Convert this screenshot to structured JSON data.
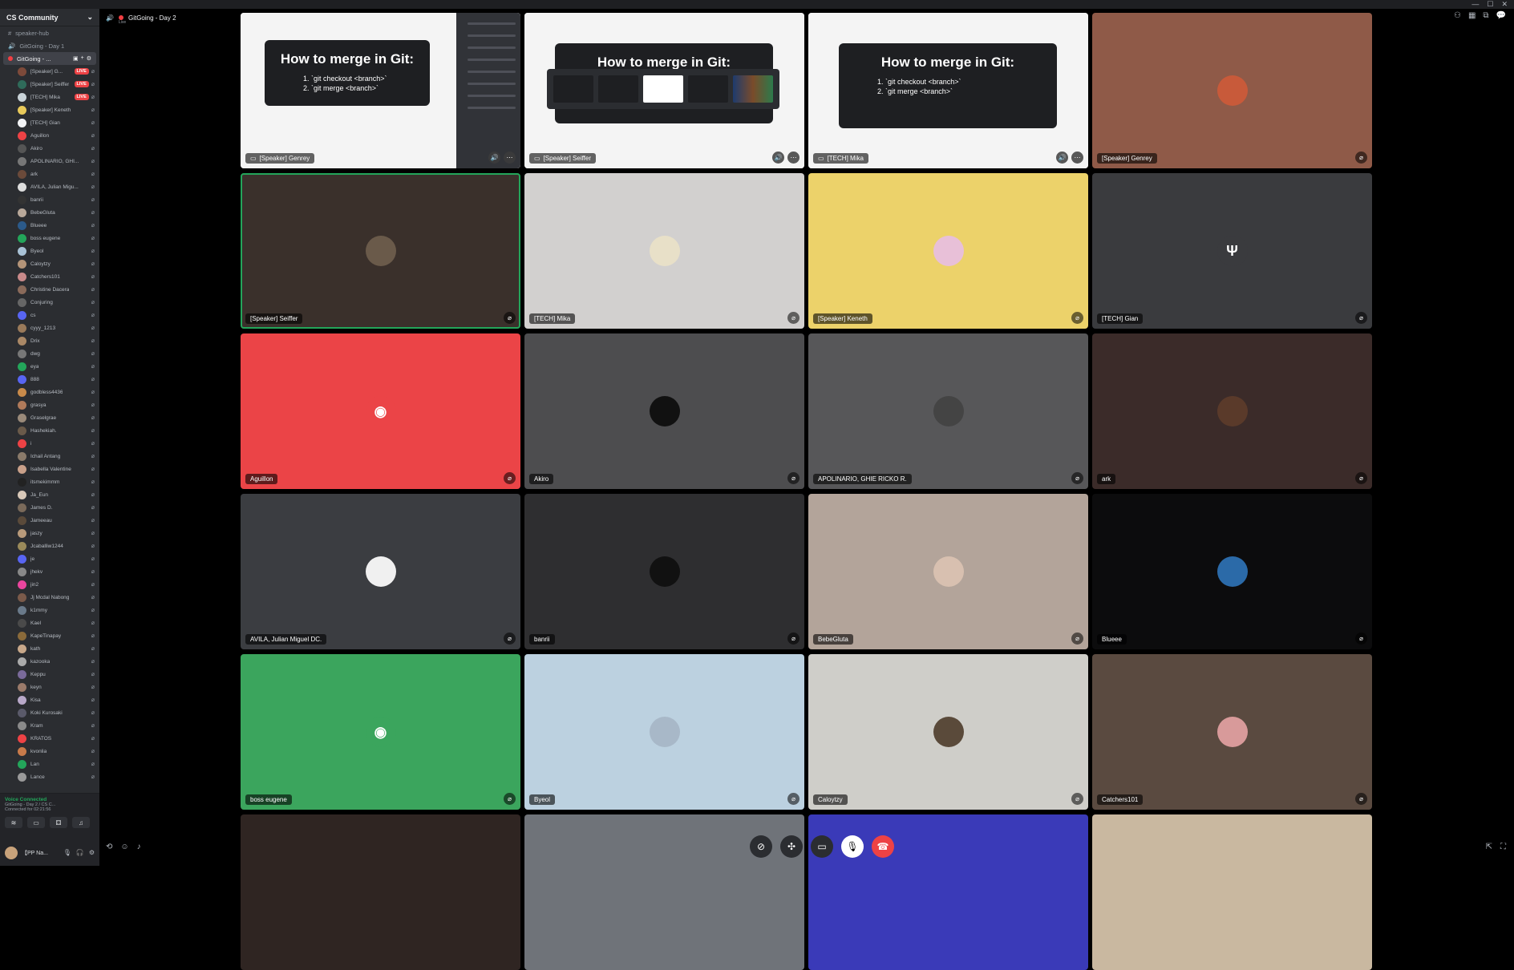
{
  "server": {
    "name": "CS Community"
  },
  "channels": [
    {
      "label": "speaker-hub",
      "icon": "hash-icon"
    },
    {
      "label": "GitGoing - Day 1",
      "icon": "speaker-icon"
    }
  ],
  "active_channel": {
    "label": "GitGoing - ..."
  },
  "members": [
    {
      "name": "[Speaker] G...",
      "live": "LIVE",
      "color": "#7d4a3a"
    },
    {
      "name": "[Speaker] Seiffer",
      "live": "LIVE",
      "color": "#2f6b5a"
    },
    {
      "name": "[TECH] Mika",
      "live": "LIVE",
      "color": "#c9d3d8"
    },
    {
      "name": "[Speaker] Keneth",
      "live": "",
      "color": "#e8c95a"
    },
    {
      "name": "[TECH] Gian",
      "live": "",
      "color": "#f2f3f5"
    },
    {
      "name": "Aguillon",
      "live": "",
      "color": "#ed4245"
    },
    {
      "name": "Akiro",
      "live": "",
      "color": "#555"
    },
    {
      "name": "APOLINARIO, GHI...",
      "live": "",
      "color": "#777"
    },
    {
      "name": "ark",
      "live": "",
      "color": "#6b4a3a"
    },
    {
      "name": "AVILA, Julian Migu...",
      "live": "",
      "color": "#ddd"
    },
    {
      "name": "banrii",
      "live": "",
      "color": "#333"
    },
    {
      "name": "BebeGluta",
      "live": "",
      "color": "#b8a89a"
    },
    {
      "name": "Blueee",
      "live": "",
      "color": "#2b5a8a"
    },
    {
      "name": "boss eugene",
      "live": "",
      "color": "#23a55a"
    },
    {
      "name": "Byeol",
      "live": "",
      "color": "#a9c2d6"
    },
    {
      "name": "Caloytzy",
      "live": "",
      "color": "#b49478"
    },
    {
      "name": "Catchers101",
      "live": "",
      "color": "#c98a8a"
    },
    {
      "name": "Christine Dacera",
      "live": "",
      "color": "#8a6a5a"
    },
    {
      "name": "Conjuring",
      "live": "",
      "color": "#666"
    },
    {
      "name": "cs",
      "live": "",
      "color": "#5865f2"
    },
    {
      "name": "cyyy_1213",
      "live": "",
      "color": "#9a7a5a"
    },
    {
      "name": "Drix",
      "live": "",
      "color": "#aa8866"
    },
    {
      "name": "dwg",
      "live": "",
      "color": "#777"
    },
    {
      "name": "eya",
      "live": "",
      "color": "#23a55a"
    },
    {
      "name": "888",
      "live": "",
      "color": "#5865f2"
    },
    {
      "name": "godbless4436",
      "live": "",
      "color": "#c88a4a"
    },
    {
      "name": "grasya",
      "live": "",
      "color": "#b07a5a"
    },
    {
      "name": "Graselgrae",
      "live": "",
      "color": "#9a8a7a"
    },
    {
      "name": "Hashekiah.",
      "live": "",
      "color": "#6a5a4a"
    },
    {
      "name": "i",
      "live": "",
      "color": "#ed4245"
    },
    {
      "name": "Ichail Antang",
      "live": "",
      "color": "#8a7a6a"
    },
    {
      "name": "Isabella Valentine",
      "live": "",
      "color": "#c9a08a"
    },
    {
      "name": "itsmekimmm",
      "live": "",
      "color": "#222"
    },
    {
      "name": "Ja_Eun",
      "live": "",
      "color": "#d8c8b8"
    },
    {
      "name": "James D.",
      "live": "",
      "color": "#7a6a5a"
    },
    {
      "name": "Jameeau",
      "live": "",
      "color": "#5a4a3a"
    },
    {
      "name": "jaszy",
      "live": "",
      "color": "#b89a7a"
    },
    {
      "name": "Jcaballiw1244",
      "live": "",
      "color": "#9a8a5a"
    },
    {
      "name": "je",
      "live": "",
      "color": "#5865f2"
    },
    {
      "name": "jhekv",
      "live": "",
      "color": "#888"
    },
    {
      "name": "jin2",
      "live": "",
      "color": "#eb459e"
    },
    {
      "name": "Jj Mcdal Nabong",
      "live": "",
      "color": "#7a5a4a"
    },
    {
      "name": "k1mmy",
      "live": "",
      "color": "#6a7a8a"
    },
    {
      "name": "Kael",
      "live": "",
      "color": "#4a4a4a"
    },
    {
      "name": "KapeTinapay",
      "live": "",
      "color": "#8a6a3a"
    },
    {
      "name": "kath",
      "live": "",
      "color": "#c8a88a"
    },
    {
      "name": "kazooka",
      "live": "",
      "color": "#aaa"
    },
    {
      "name": "Keppu",
      "live": "",
      "color": "#7a6a9a"
    },
    {
      "name": "keyn",
      "live": "",
      "color": "#9a7a6a"
    },
    {
      "name": "Kisa",
      "live": "",
      "color": "#b8a8c8"
    },
    {
      "name": "Koki Kurosaki",
      "live": "",
      "color": "#5a5a6a"
    },
    {
      "name": "Kram",
      "live": "",
      "color": "#8a8a8a"
    },
    {
      "name": "KRATOS",
      "live": "",
      "color": "#ed4245"
    },
    {
      "name": "kvonlia",
      "live": "",
      "color": "#c87a4a"
    },
    {
      "name": "Lan",
      "live": "",
      "color": "#23a55a"
    },
    {
      "name": "Lance",
      "live": "",
      "color": "#9a9a9a"
    }
  ],
  "voice": {
    "status": "Voice Connected",
    "channel": "GitGoing - Day 2 / CS C...",
    "duration": "Connected for 02:21:56"
  },
  "user": {
    "name": "【PP Na..."
  },
  "topbar": {
    "title": "GitGoing - Day 2",
    "sub": "Live"
  },
  "slide": {
    "title": "How to merge in Git:",
    "steps": [
      "`git checkout <branch>`",
      "`git merge <branch>`"
    ]
  },
  "tiles": [
    {
      "name": "[Speaker] Genrey",
      "type": "slide",
      "bg": "#f4f4f4"
    },
    {
      "name": "[Speaker] Seiffer",
      "type": "switcher",
      "bg": "#f4f4f4",
      "slide_title": "How to merge in Git:"
    },
    {
      "name": "[TECH] Mika",
      "type": "slide",
      "bg": "#f4f4f4"
    },
    {
      "name": "[Speaker] Genrey",
      "type": "avatar",
      "bg": "#8f5a48",
      "avatar": "#c85a3a"
    },
    {
      "name": "[Speaker] Seiffer",
      "type": "avatar",
      "bg": "#3a302b",
      "avatar": "#6a5a4a",
      "speaking": true
    },
    {
      "name": "[TECH] Mika",
      "type": "avatar",
      "bg": "#d2d0cf",
      "avatar": "#e8e0c8"
    },
    {
      "name": "[Speaker] Keneth",
      "type": "avatar",
      "bg": "#ecd26a",
      "avatar": "#e8c0d8"
    },
    {
      "name": "[TECH] Gian",
      "type": "avatar",
      "bg": "#3a3b3e",
      "avatar": "#3a3b3e",
      "glyph": "Ψ"
    },
    {
      "name": "Aguillon",
      "type": "avatar",
      "bg": "#eb4447",
      "avatar": "#eb4447",
      "glyph": "◉"
    },
    {
      "name": "Akiro",
      "type": "avatar",
      "bg": "#4d4d4f",
      "avatar": "#111"
    },
    {
      "name": "APOLINARIO, GHIE RICKO R.",
      "type": "avatar",
      "bg": "#575759",
      "avatar": "#444"
    },
    {
      "name": "ark",
      "type": "avatar",
      "bg": "#3b2b29",
      "avatar": "#5a3a2a"
    },
    {
      "name": "AVILA, Julian Miguel DC.",
      "type": "avatar",
      "bg": "#3b3d41",
      "avatar": "#f0f0f0"
    },
    {
      "name": "banrii",
      "type": "avatar",
      "bg": "#2e2e30",
      "avatar": "#111"
    },
    {
      "name": "BebeGluta",
      "type": "avatar",
      "bg": "#b3a49a",
      "avatar": "#d8c0b0"
    },
    {
      "name": "Blueee",
      "type": "avatar",
      "bg": "#0c0c0d",
      "avatar": "#2b6aa8"
    },
    {
      "name": "boss eugene",
      "type": "avatar",
      "bg": "#3ba55d",
      "avatar": "#3ba55d",
      "glyph": "◉"
    },
    {
      "name": "Byeol",
      "type": "avatar",
      "bg": "#bcd1e0",
      "avatar": "#a8b8c8"
    },
    {
      "name": "Caloytzy",
      "type": "avatar",
      "bg": "#cfcec9",
      "avatar": "#5a4a3a"
    },
    {
      "name": "Catchers101",
      "type": "avatar",
      "bg": "#5a4a40",
      "avatar": "#d89a9a"
    },
    {
      "name": "",
      "type": "empty",
      "bg": "#2f2522"
    },
    {
      "name": "",
      "type": "empty",
      "bg": "#6f7379"
    },
    {
      "name": "",
      "type": "empty",
      "bg": "#3a3ab8"
    },
    {
      "name": "",
      "type": "empty",
      "bg": "#c9b8a0"
    }
  ]
}
